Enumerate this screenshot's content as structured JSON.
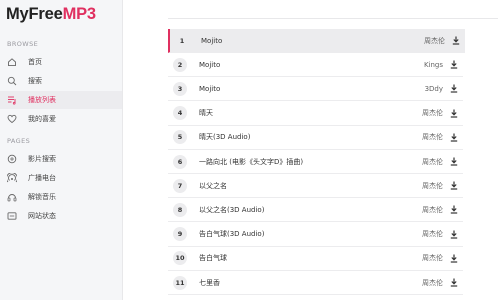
{
  "app": {
    "title_part1": "MyFree",
    "title_part2": "MP3"
  },
  "sidebar": {
    "browse_title": "BROWSE",
    "pages_title": "PAGES",
    "browse_items": [
      {
        "label": "首页",
        "icon": "home-icon"
      },
      {
        "label": "搜索",
        "icon": "search-icon"
      },
      {
        "label": "播放列表",
        "icon": "playlist-icon",
        "active": true
      },
      {
        "label": "我的喜爱",
        "icon": "heart-icon"
      }
    ],
    "page_items": [
      {
        "label": "影片搜索",
        "icon": "film-search-icon"
      },
      {
        "label": "广播电台",
        "icon": "radio-icon"
      },
      {
        "label": "解锁音乐",
        "icon": "unlock-icon"
      },
      {
        "label": "网站状态",
        "icon": "status-icon"
      }
    ]
  },
  "songs": [
    {
      "num": "1",
      "title": "Mojito",
      "artist": "周杰伦",
      "active": true
    },
    {
      "num": "2",
      "title": "Mojito",
      "artist": "Kings"
    },
    {
      "num": "3",
      "title": "Mojito",
      "artist": "3Ddy"
    },
    {
      "num": "4",
      "title": "晴天",
      "artist": "周杰伦"
    },
    {
      "num": "5",
      "title": "晴天(3D Audio)",
      "artist": "周杰伦"
    },
    {
      "num": "6",
      "title": "一路向北 (电影《头文字D》插曲)",
      "artist": "周杰伦"
    },
    {
      "num": "7",
      "title": "以父之名",
      "artist": "周杰伦"
    },
    {
      "num": "8",
      "title": "以父之名(3D Audio)",
      "artist": "周杰伦"
    },
    {
      "num": "9",
      "title": "告白气球(3D Audio)",
      "artist": "周杰伦"
    },
    {
      "num": "10",
      "title": "告白气球",
      "artist": "周杰伦"
    },
    {
      "num": "11",
      "title": "七里香",
      "artist": "周杰伦"
    }
  ],
  "colors": {
    "accent": "#e03060"
  }
}
